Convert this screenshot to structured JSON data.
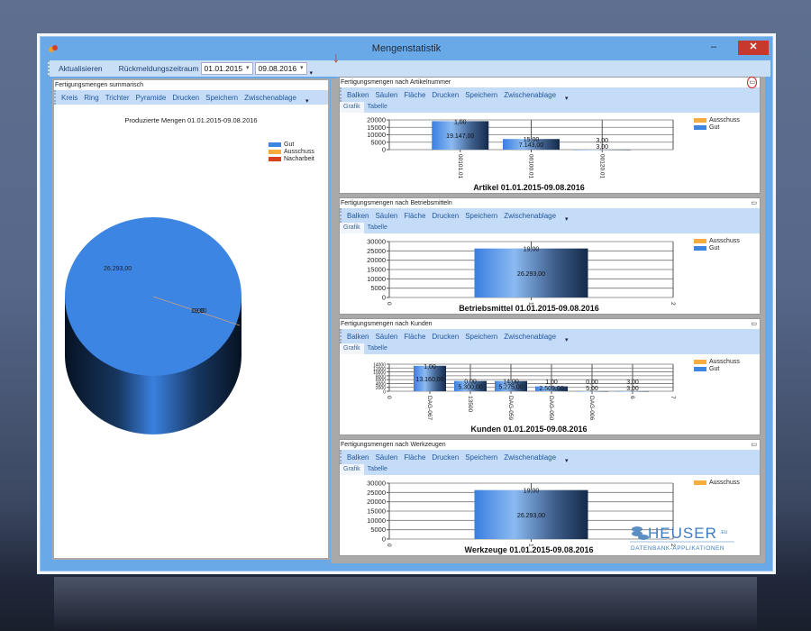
{
  "window": {
    "title": "Mengenstatistik",
    "min": "–",
    "max": "☐",
    "close": "✕"
  },
  "toolbar": {
    "refresh": "Aktualisieren",
    "period_label": "Rückmeldungszeitraum",
    "date_from": "01.01.2015",
    "date_to": "09.08.2016"
  },
  "left": {
    "title": "Fertigungsmengen summarisch",
    "menu": [
      "Kreis",
      "Ring",
      "Trichter",
      "Pyramide",
      "Drucken",
      "Speichern",
      "Zwischenablage"
    ],
    "chart_title": "Produzierte Mengen  01.01.2015-09.08.2016",
    "legend": [
      "Gut",
      "Ausschuss",
      "Nacharbeit"
    ],
    "main_label": "26.293,00",
    "small_label": "19,00",
    "small_label2": "0,00"
  },
  "panel_menu": [
    "Balken",
    "Säulen",
    "Fläche",
    "Drucken",
    "Speichern",
    "Zwischenablage"
  ],
  "tabs": [
    "Grafik",
    "Tabelle"
  ],
  "colors": {
    "gut": "#3d85e3",
    "ausschuss": "#f6ad3c",
    "nacharbeit": "#d9401c"
  },
  "logo": {
    "name": "HEUSER",
    "suffix": ".EU",
    "tagline": "DATENBANK-APPLIKATIONEN"
  },
  "chart_data": [
    {
      "type": "bar",
      "panel_title": "Fertigungsmengen nach Artikelnummer",
      "title": "Artikel 01.01.2015-09.08.2016",
      "categories": [
        "00101.01",
        "00100.01",
        "00120.01"
      ],
      "xticks": [],
      "xmax": 4,
      "yticks": [
        "0",
        "5000",
        "10000",
        "15000",
        "20000"
      ],
      "ylim": [
        0,
        20000
      ],
      "series": [
        {
          "name": "Ausschuss",
          "values": [
            1,
            15,
            3
          ],
          "labels": [
            "1,00",
            "15,00",
            "3,00"
          ]
        },
        {
          "name": "Gut",
          "values": [
            19147,
            7143,
            3
          ],
          "labels": [
            "19.147,00",
            "7.143,00",
            "3,00"
          ]
        }
      ],
      "legend": [
        "Ausschuss",
        "Gut"
      ]
    },
    {
      "type": "bar",
      "panel_title": "Fertigungsmengen nach Betriebsmitteln",
      "title": "Betriebsmittel 01.01.2015-09.08.2016",
      "categories": [
        ""
      ],
      "xticks": [
        "0",
        "1",
        "2"
      ],
      "xmax": 2,
      "yticks": [
        "0",
        "5000",
        "10000",
        "15000",
        "20000",
        "25000",
        "30000"
      ],
      "ylim": [
        0,
        30000
      ],
      "series": [
        {
          "name": "Ausschuss",
          "values": [
            19
          ],
          "labels": [
            "19,00"
          ]
        },
        {
          "name": "Gut",
          "values": [
            26293
          ],
          "labels": [
            "26.293,00"
          ]
        }
      ],
      "legend": [
        "Ausschuss",
        "Gut"
      ]
    },
    {
      "type": "bar",
      "panel_title": "Fertigungsmengen nach Kunden",
      "title": "Kunden 01.01.2015-09.08.2016",
      "categories": [
        "DAG-067",
        "13500",
        "DAG-059",
        "DAG-050",
        "DAG-006",
        "6"
      ],
      "xticks": [
        "0",
        "7"
      ],
      "xmax": 7,
      "yticks": [
        "0",
        "2000",
        "4000",
        "6000",
        "8000",
        "10000",
        "12000",
        "14000"
      ],
      "ylim": [
        0,
        14000
      ],
      "series": [
        {
          "name": "Ausschuss",
          "values": [
            1,
            0,
            14,
            1,
            0,
            3
          ],
          "labels": [
            "1,00",
            "0,00",
            "14,00",
            "1,00",
            "0,00",
            "3,00"
          ]
        },
        {
          "name": "Gut",
          "values": [
            13160,
            5300,
            5275,
            2509,
            5,
            3
          ],
          "labels": [
            "13.160,00",
            "5.300,00",
            "5.275,00",
            "2.509,00",
            "5,00",
            "3,00"
          ]
        }
      ],
      "legend": [
        "Ausschuss",
        "Gut"
      ]
    },
    {
      "type": "bar",
      "panel_title": "Fertigungsmengen nach Werkzeugen",
      "title": "Werkzeuge 01.01.2015-09.08.2016",
      "categories": [
        ""
      ],
      "xticks": [
        "0",
        "1",
        "2"
      ],
      "xmax": 2,
      "yticks": [
        "0",
        "5000",
        "10000",
        "15000",
        "20000",
        "25000",
        "30000"
      ],
      "ylim": [
        0,
        30000
      ],
      "series": [
        {
          "name": "Ausschuss",
          "values": [
            19
          ],
          "labels": [
            "19,00"
          ]
        },
        {
          "name": "Gut",
          "values": [
            26293
          ],
          "labels": [
            "26.293,00"
          ]
        }
      ],
      "legend": [
        "Ausschuss"
      ]
    }
  ]
}
